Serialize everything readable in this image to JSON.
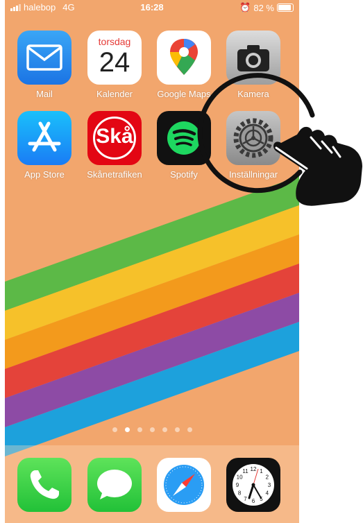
{
  "status_bar": {
    "carrier": "halebop",
    "network": "4G",
    "time": "16:28",
    "battery": "82 %",
    "battery_level": 0.82
  },
  "home_row1": [
    {
      "label": "Mail",
      "icon": "mail-icon"
    },
    {
      "label": "Kalender",
      "icon": "calendar-icon",
      "weekday": "torsdag",
      "day": "24"
    },
    {
      "label": "Google Maps",
      "icon": "google-maps-icon"
    },
    {
      "label": "Kamera",
      "icon": "camera-icon"
    }
  ],
  "home_row2": [
    {
      "label": "App Store",
      "icon": "app-store-icon"
    },
    {
      "label": "Skånetrafiken",
      "icon": "skanetrafiken-icon",
      "logo_text": "Skå"
    },
    {
      "label": "Spotify",
      "icon": "spotify-icon"
    },
    {
      "label": "Inställningar",
      "icon": "settings-gear-icon"
    }
  ],
  "page_dots": {
    "count": 7,
    "active_index": 1
  },
  "dock": [
    {
      "name": "phone",
      "icon": "phone-icon"
    },
    {
      "name": "messages",
      "icon": "messages-icon"
    },
    {
      "name": "safari",
      "icon": "safari-compass-icon"
    },
    {
      "name": "clock",
      "icon": "clock-icon",
      "numbers": [
        "12",
        "1",
        "2",
        "3",
        "4",
        "5",
        "6",
        "7",
        "8",
        "9",
        "10",
        "11"
      ]
    }
  ],
  "colors": {
    "wallpaper": "#f2a66d",
    "stripes": [
      "#5cb947",
      "#f6c12a",
      "#f39a1c",
      "#e4433a",
      "#8d4ba5",
      "#1da1dc"
    ]
  },
  "overlay": {
    "icon": "pointing-hand-icon"
  }
}
